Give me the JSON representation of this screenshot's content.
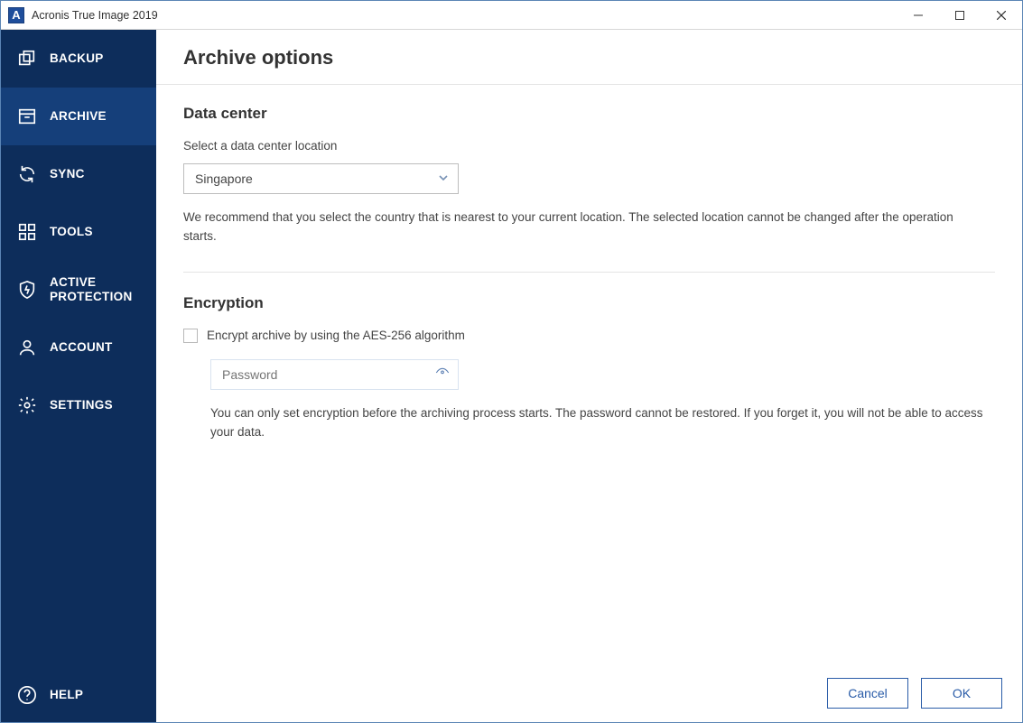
{
  "window": {
    "title": "Acronis True Image 2019",
    "app_icon_letter": "A"
  },
  "sidebar": {
    "active_index": 1,
    "items": [
      {
        "key": "backup",
        "label": "BACKUP"
      },
      {
        "key": "archive",
        "label": "ARCHIVE"
      },
      {
        "key": "sync",
        "label": "SYNC"
      },
      {
        "key": "tools",
        "label": "TOOLS"
      },
      {
        "key": "active-protection",
        "label": "ACTIVE PROTECTION"
      },
      {
        "key": "account",
        "label": "ACCOUNT"
      },
      {
        "key": "settings",
        "label": "SETTINGS"
      }
    ],
    "footer": {
      "label": "HELP"
    }
  },
  "page": {
    "title": "Archive options",
    "datacenter": {
      "heading": "Data center",
      "label": "Select a data center location",
      "selected": "Singapore",
      "help": "We recommend that you select the country that is nearest to your current location. The selected location cannot be changed after the operation starts."
    },
    "encryption": {
      "heading": "Encryption",
      "checkbox_label": "Encrypt archive by using the AES-256 algorithm",
      "checkbox_checked": false,
      "password_placeholder": "Password",
      "password_value": "",
      "help": "You can only set encryption before the archiving process starts. The password cannot be restored. If you forget it, you will not be able to access your data."
    },
    "buttons": {
      "cancel": "Cancel",
      "ok": "OK"
    }
  }
}
